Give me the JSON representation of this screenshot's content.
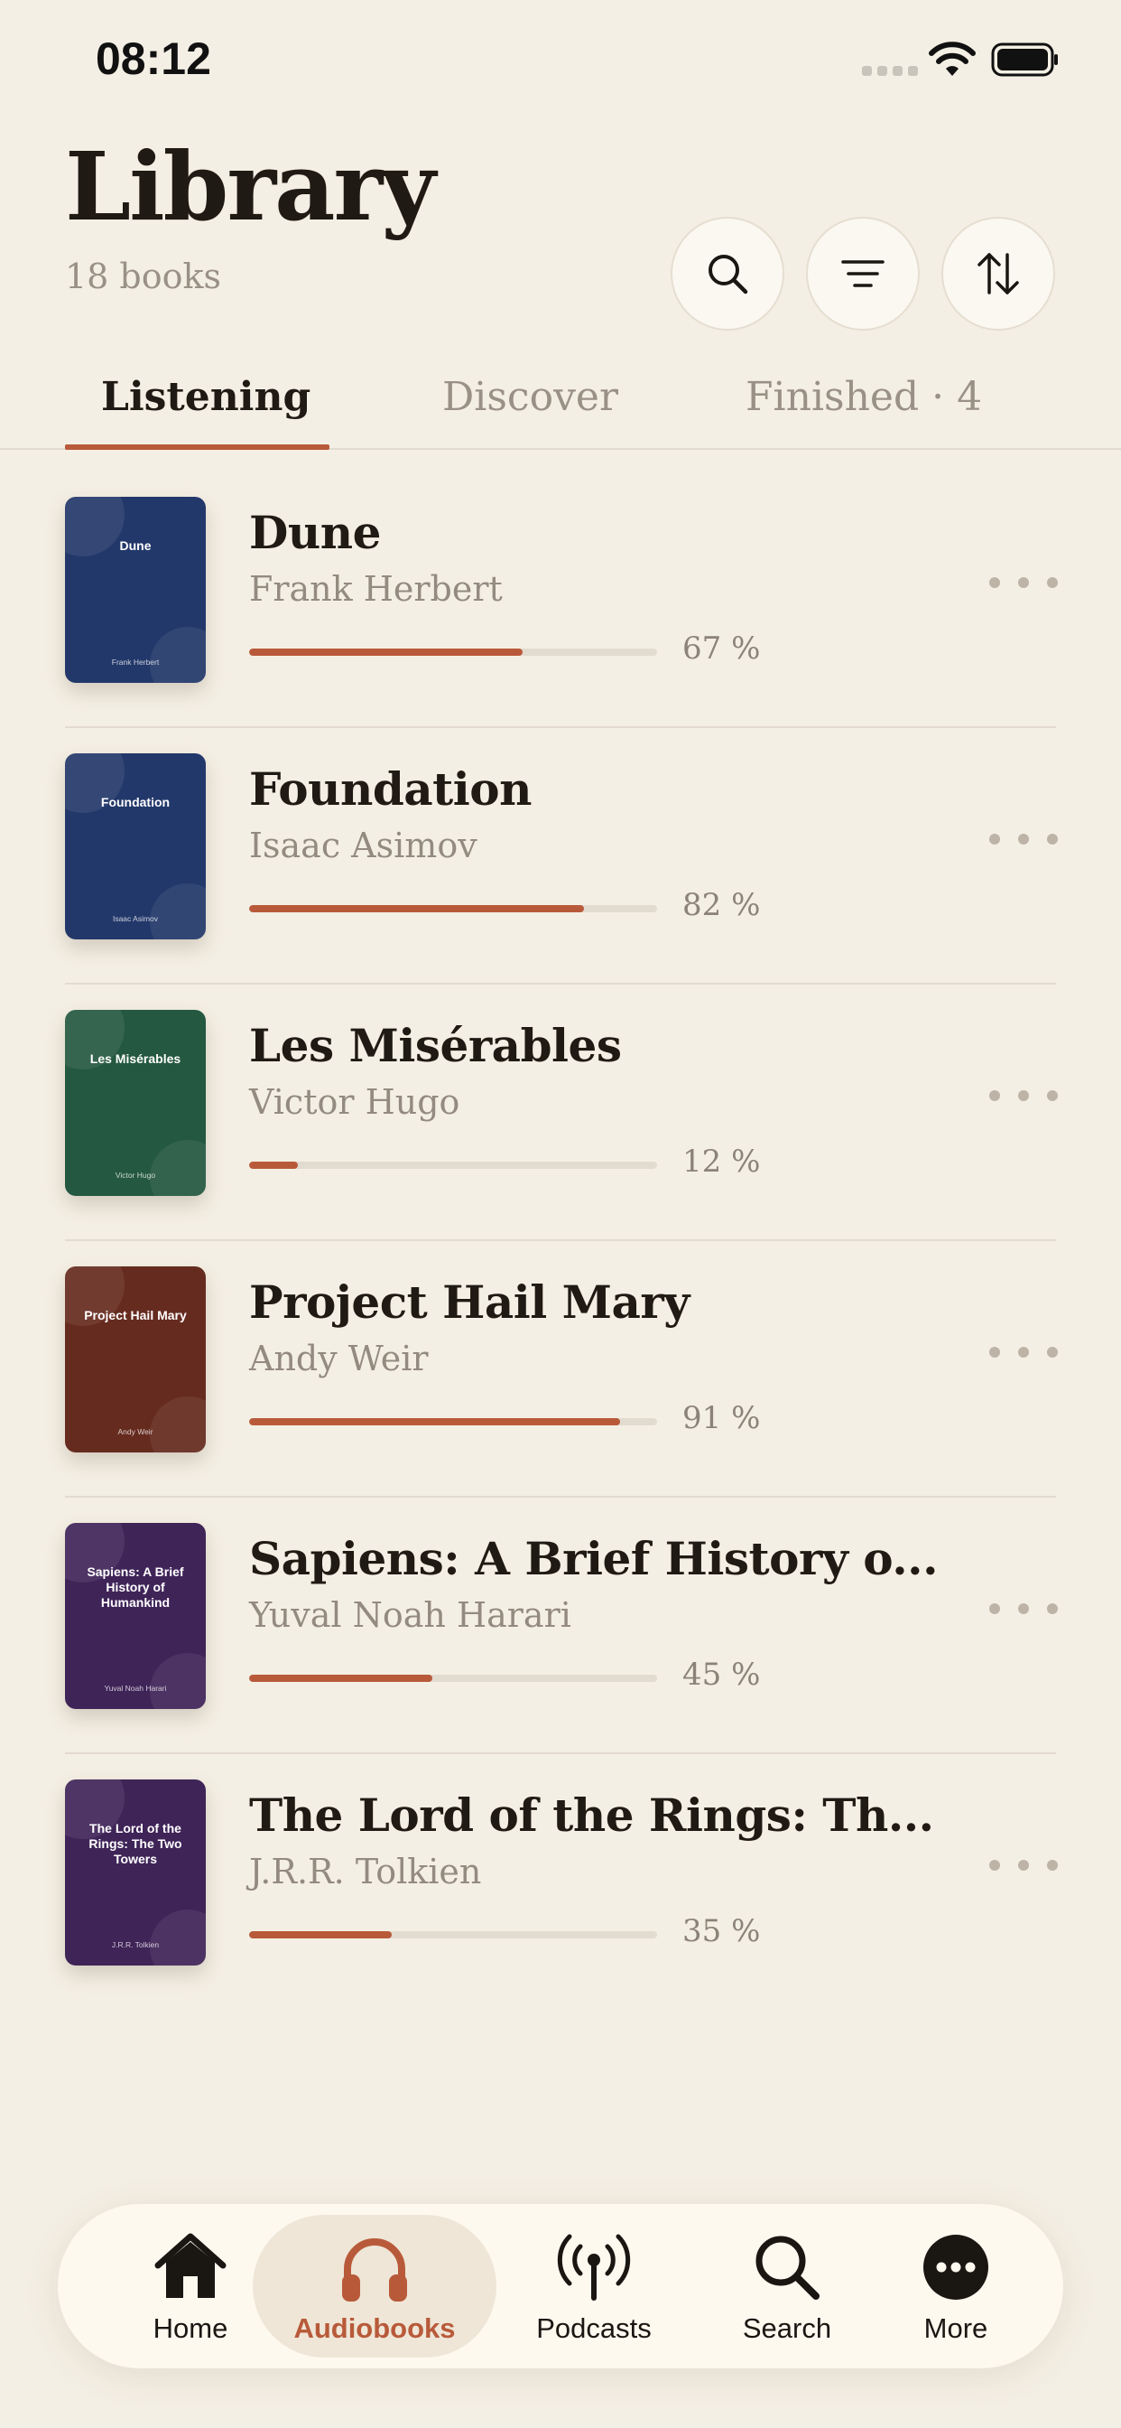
{
  "status_bar": {
    "time": "08:12"
  },
  "header": {
    "title": "Library",
    "subtitle": "18 books"
  },
  "header_buttons": [
    "search-icon",
    "filter-icon",
    "sort-icon"
  ],
  "tabs": [
    {
      "label": "Listening",
      "active": true
    },
    {
      "label": "Discover",
      "active": false
    },
    {
      "label": "Finished · 4",
      "active": false
    }
  ],
  "books": [
    {
      "title": "Dune",
      "author": "Frank Herbert",
      "progress": 67,
      "progress_label": "67 %",
      "cover_title": "Dune",
      "cover_author": "Frank Herbert",
      "cover_color": "#23386a"
    },
    {
      "title": "Foundation",
      "author": "Isaac Asimov",
      "progress": 82,
      "progress_label": "82 %",
      "cover_title": "Foundation",
      "cover_author": "Isaac Asimov",
      "cover_color": "#23386a"
    },
    {
      "title": "Les Misérables",
      "author": "Victor Hugo",
      "progress": 12,
      "progress_label": "12 %",
      "cover_title": "Les Misérables",
      "cover_author": "Victor Hugo",
      "cover_color": "#245840"
    },
    {
      "title": "Project Hail Mary",
      "author": "Andy Weir",
      "progress": 91,
      "progress_label": "91 %",
      "cover_title": "Project Hail Mary",
      "cover_author": "Andy Weir",
      "cover_color": "#662b1f"
    },
    {
      "title": "Sapiens: A Brief History o...",
      "author": "Yuval Noah Harari",
      "progress": 45,
      "progress_label": "45 %",
      "cover_title": "Sapiens: A Brief History of Humankind",
      "cover_author": "Yuval Noah Harari",
      "cover_color": "#3f2458"
    },
    {
      "title": "The Lord of the Rings: Th...",
      "author": "J.R.R. Tolkien",
      "progress": 35,
      "progress_label": "35 %",
      "cover_title": "The Lord of the Rings: The Two Towers",
      "cover_author": "J.R.R. Tolkien",
      "cover_color": "#3f2458"
    }
  ],
  "bottom_nav": [
    {
      "label": "Home",
      "icon": "home-icon",
      "active": false
    },
    {
      "label": "Audiobooks",
      "icon": "headphones-icon",
      "active": true
    },
    {
      "label": "Podcasts",
      "icon": "podcast-icon",
      "active": false
    },
    {
      "label": "Search",
      "icon": "search-icon",
      "active": false
    },
    {
      "label": "More",
      "icon": "more-icon",
      "active": false
    }
  ],
  "colors": {
    "background": "#f4efe4",
    "accent": "#b85a3a",
    "text": "#201a14",
    "muted": "#948b80"
  }
}
